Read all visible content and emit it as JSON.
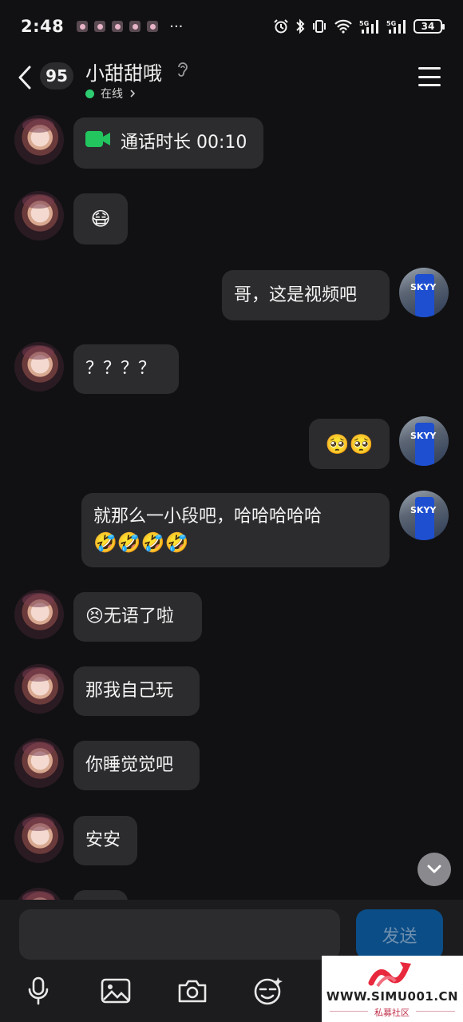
{
  "status_bar": {
    "time": "2:48",
    "dots": "···",
    "battery": "34"
  },
  "header": {
    "unread_count": "95",
    "contact_name": "小甜甜哦",
    "online_status": "在线"
  },
  "messages": [
    {
      "from": "them",
      "text": "通话时长 00:10",
      "type": "call"
    },
    {
      "from": "them",
      "text": "😷"
    },
    {
      "from": "me",
      "text": "哥，这是视频吧"
    },
    {
      "from": "them",
      "text": "？？？？"
    },
    {
      "from": "me",
      "text": "🥺🥺"
    },
    {
      "from": "me",
      "text": "就那么一小段吧，哈哈哈哈哈",
      "text2": "🤣🤣🤣🤣"
    },
    {
      "from": "them",
      "text": "😣无语了啦"
    },
    {
      "from": "them",
      "text": "那我自己玩"
    },
    {
      "from": "them",
      "text": "你睡觉觉吧"
    },
    {
      "from": "them",
      "text": "安安"
    }
  ],
  "input": {
    "value": "",
    "send_label": "发送"
  },
  "watermark": {
    "url": "WWW.SIMU001.CN",
    "sub": "私募社区"
  },
  "colors": {
    "background": "#111113",
    "bubble": "#2c2c2e",
    "online": "#2ecc71",
    "send_button": "#0b4d87",
    "call_icon": "#22c55e"
  }
}
